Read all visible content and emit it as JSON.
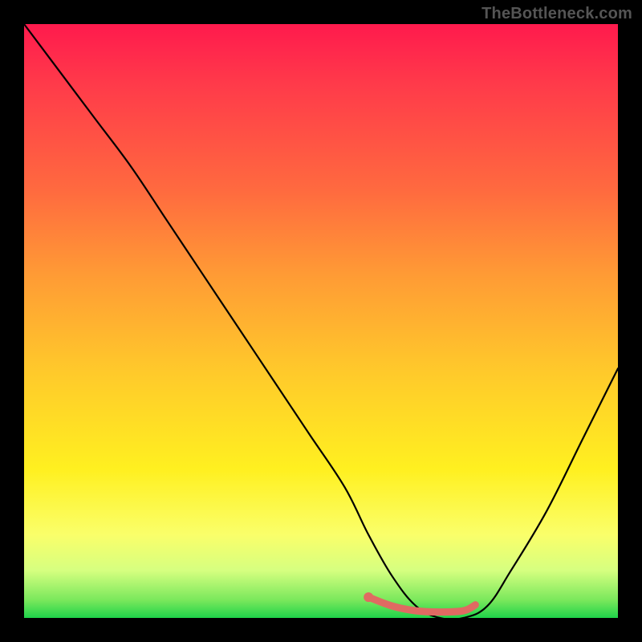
{
  "watermark": "TheBottleneck.com",
  "chart_data": {
    "type": "line",
    "title": "",
    "xlabel": "",
    "ylabel": "",
    "xlim": [
      0,
      100
    ],
    "ylim": [
      0,
      100
    ],
    "series": [
      {
        "name": "bottleneck-curve",
        "x": [
          0,
          6,
          12,
          18,
          24,
          30,
          36,
          42,
          48,
          54,
          58,
          62,
          66,
          70,
          74,
          78,
          82,
          88,
          94,
          100
        ],
        "values": [
          100,
          92,
          84,
          76,
          67,
          58,
          49,
          40,
          31,
          22,
          14,
          7,
          2,
          0,
          0,
          2,
          8,
          18,
          30,
          42
        ]
      }
    ],
    "highlight": {
      "name": "flat-minimum-marker",
      "color": "#e06a62",
      "x": [
        58,
        62,
        66,
        70,
        74,
        76
      ],
      "values": [
        3.5,
        2.0,
        1.2,
        1.0,
        1.2,
        2.2
      ]
    },
    "background_gradient": {
      "top": "#ff1a4d",
      "mid1": "#ff9a35",
      "mid2": "#fff020",
      "bottom": "#1fd34a"
    }
  }
}
